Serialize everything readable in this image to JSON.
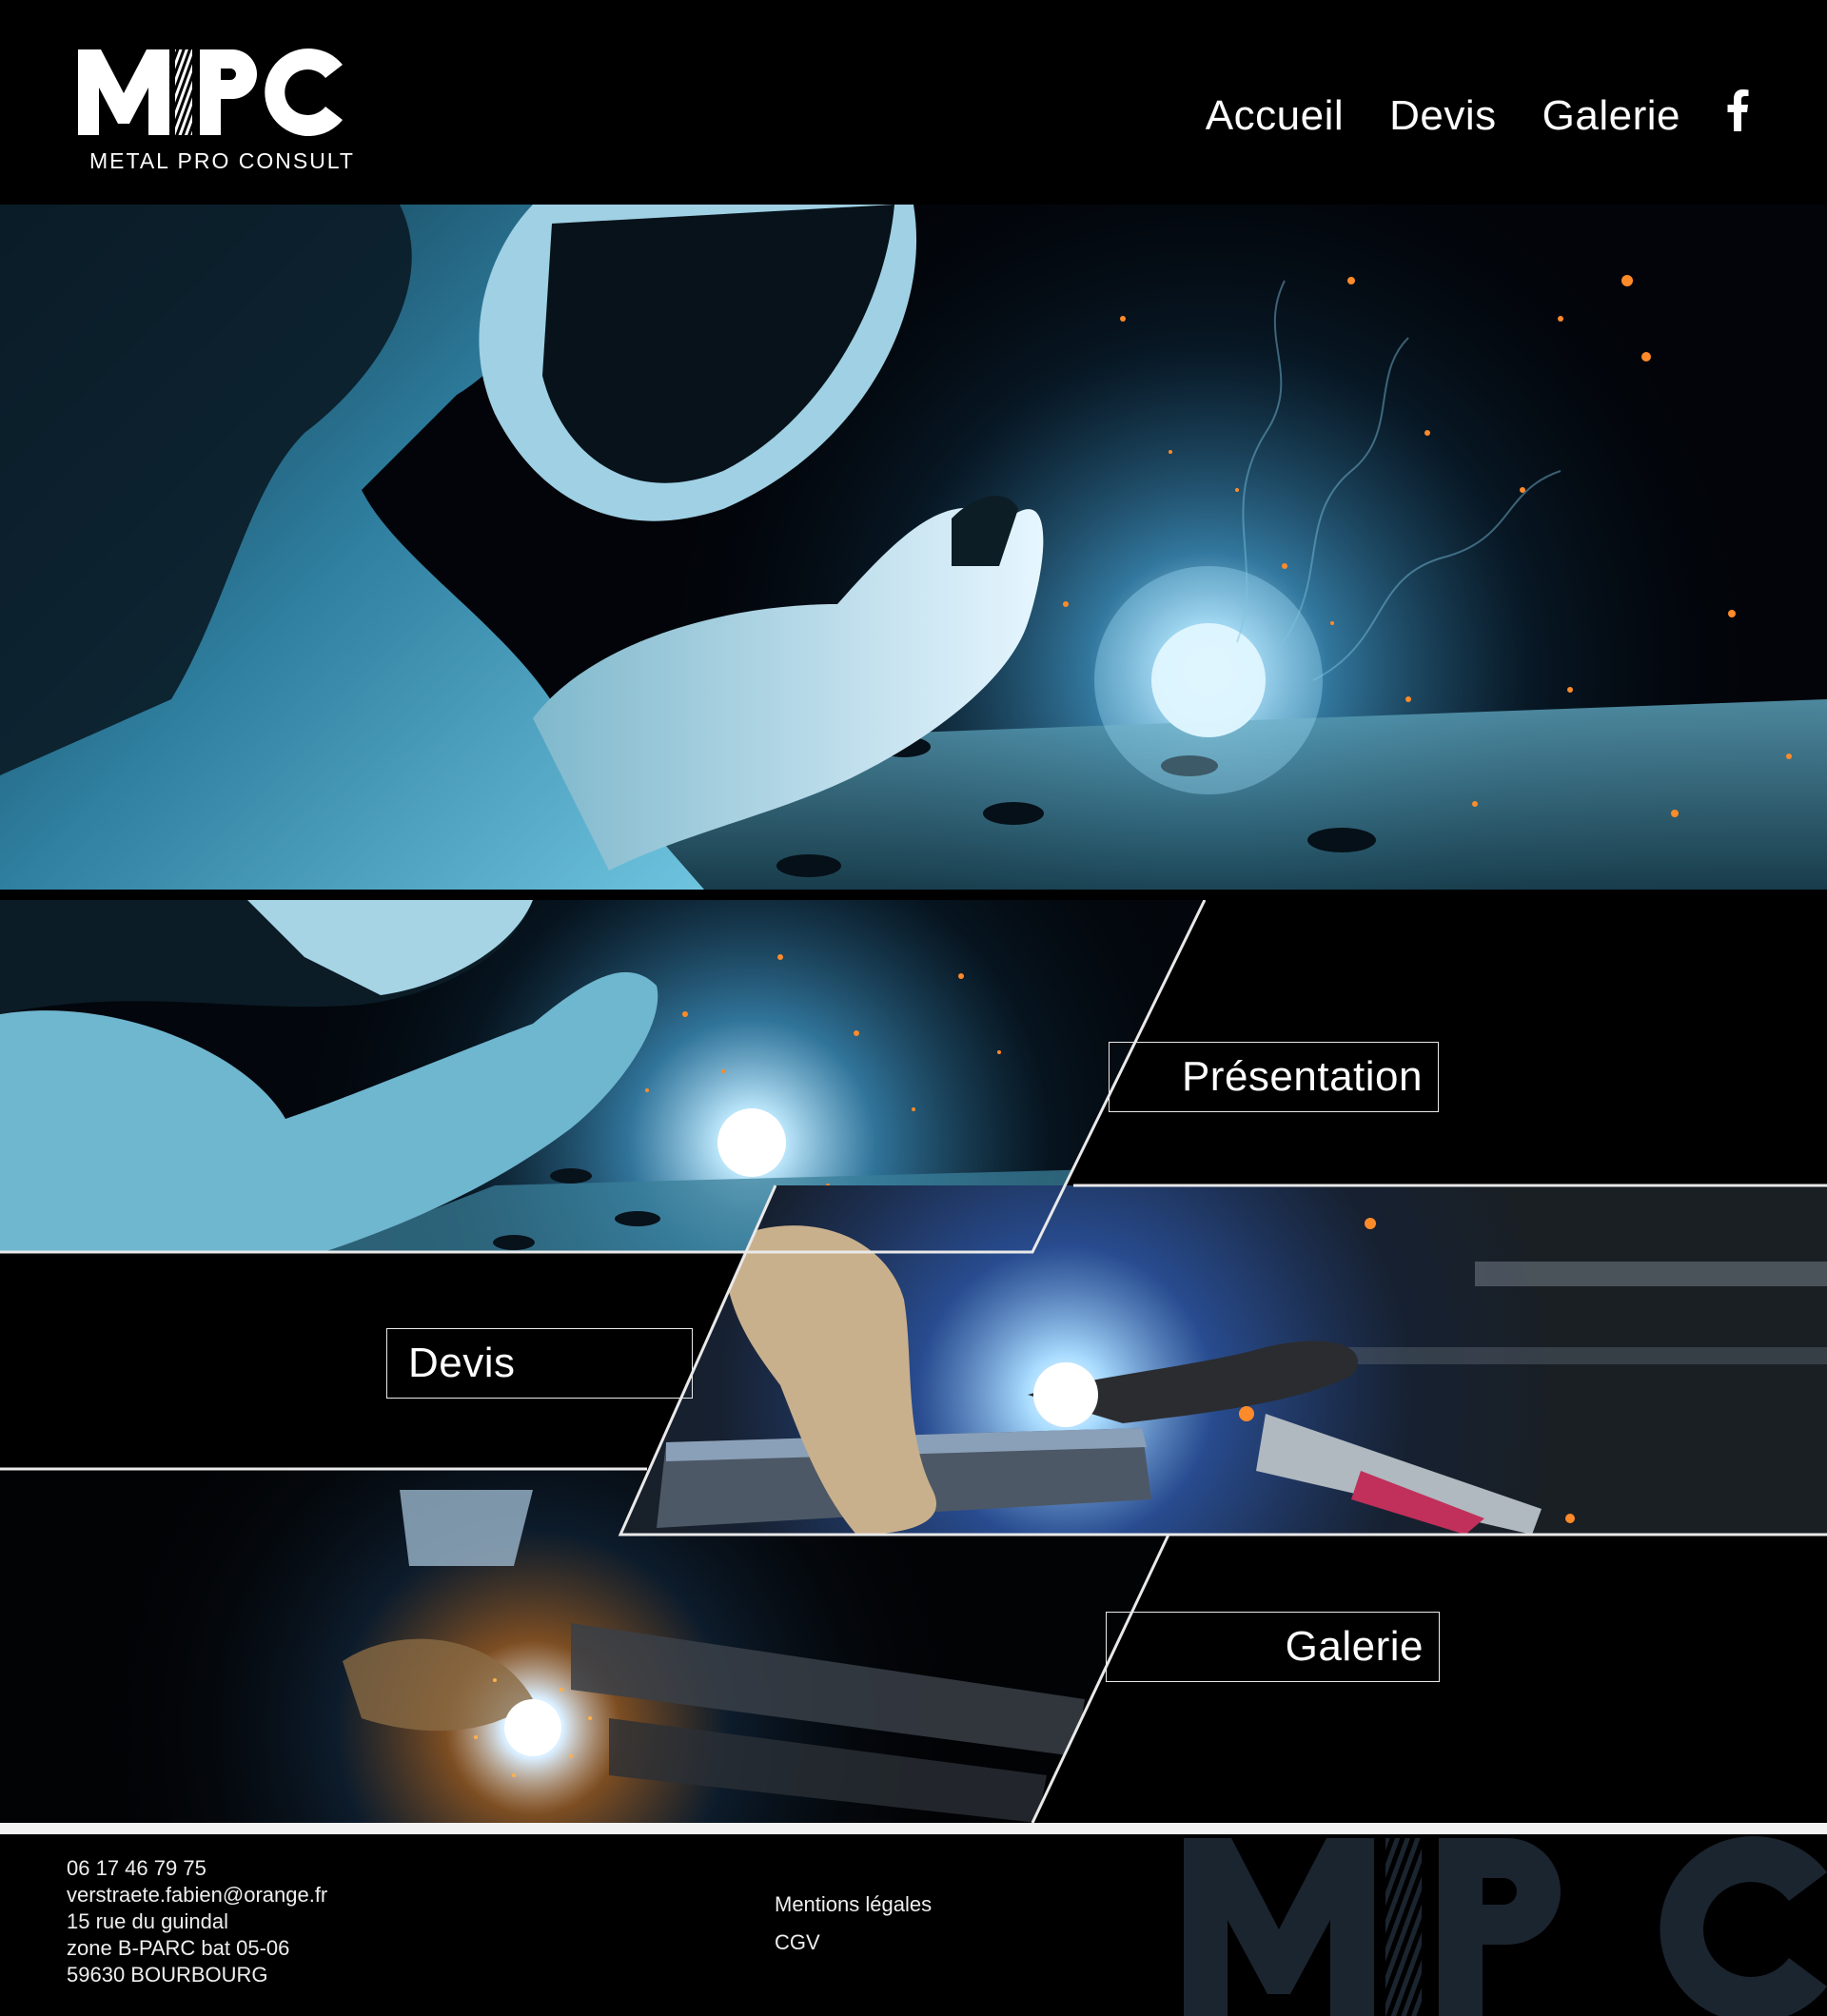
{
  "brand": {
    "logo_letters": "MPC",
    "tagline": "METAL PRO CONSULT"
  },
  "nav": {
    "items": [
      {
        "label": "Accueil"
      },
      {
        "label": "Devis"
      },
      {
        "label": "Galerie"
      }
    ],
    "social_icon": "facebook-icon"
  },
  "sections": {
    "presentation_label": "Présentation",
    "devis_label": "Devis",
    "galerie_label": "Galerie"
  },
  "footer": {
    "phone": "06 17 46 79 75",
    "email": "verstraete.fabien@orange.fr",
    "address_line1": "15 rue du guindal",
    "address_line2": "zone B-PARC bat 05-06",
    "address_line3": "59630 BOURBOURG",
    "legal_links": [
      {
        "label": "Mentions légales"
      },
      {
        "label": "CGV"
      }
    ],
    "watermark_letters": "MPC"
  },
  "colors": {
    "background": "#000000",
    "accent_blue": "#3aa8d8",
    "spark_orange": "#ff8a2a",
    "footer_logo": "#1b2530"
  }
}
